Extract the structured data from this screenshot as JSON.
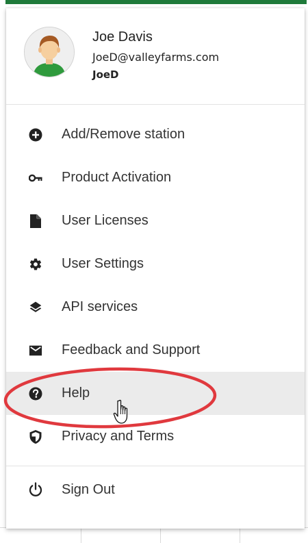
{
  "user": {
    "name": "Joe Davis",
    "email": "JoeD@valleyfarms.com",
    "handle": "JoeD",
    "avatar_icon": "user-avatar-icon"
  },
  "menu": {
    "items": [
      {
        "label": "Add/Remove station",
        "icon": "plus-circle-icon"
      },
      {
        "label": "Product Activation",
        "icon": "key-icon"
      },
      {
        "label": "User Licenses",
        "icon": "document-icon"
      },
      {
        "label": "User Settings",
        "icon": "gear-icon"
      },
      {
        "label": "API services",
        "icon": "layers-icon"
      },
      {
        "label": "Feedback and Support",
        "icon": "envelope-icon"
      },
      {
        "label": "Help",
        "icon": "question-circle-icon",
        "active": true
      },
      {
        "label": "Privacy and Terms",
        "icon": "shield-icon"
      }
    ],
    "sign_out": {
      "label": "Sign Out",
      "icon": "power-icon"
    }
  },
  "colors": {
    "accent": "#1f7a3a",
    "hover_bg": "#ebebeb",
    "annotation": "#e0393e"
  }
}
